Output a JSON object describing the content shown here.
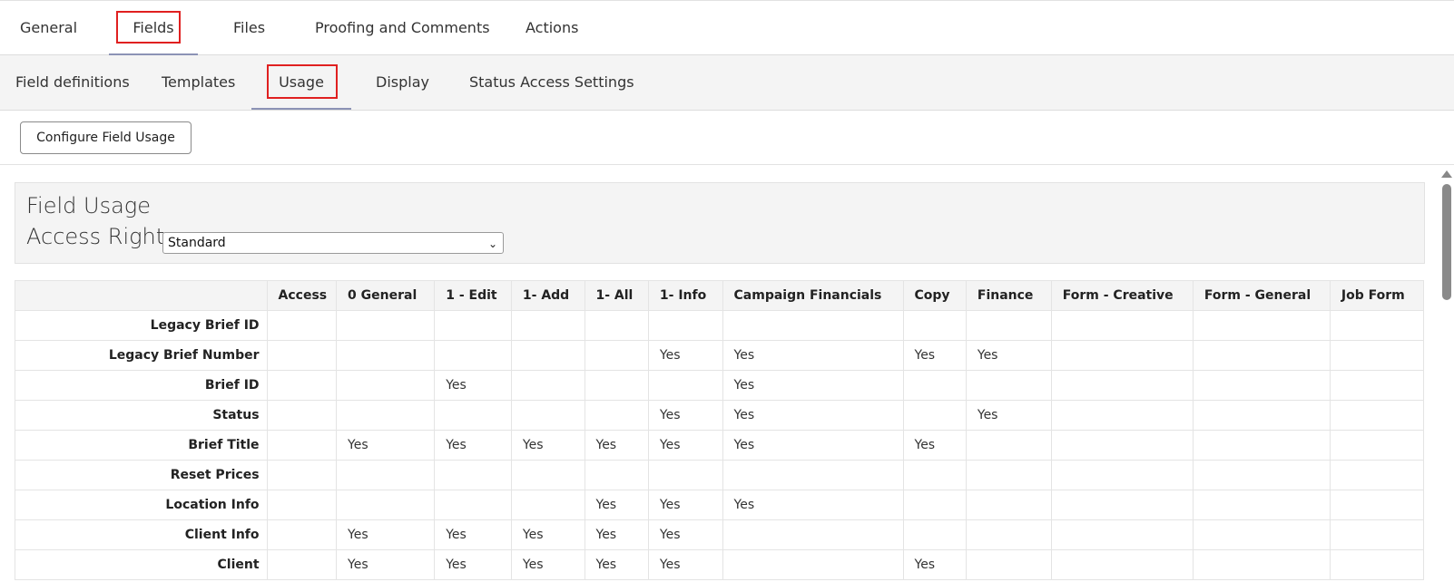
{
  "top_tabs": [
    "General",
    "Fields",
    "Files",
    "Proofing and Comments",
    "Actions"
  ],
  "sub_tabs": [
    "Field definitions",
    "Templates",
    "Usage",
    "Display",
    "Status Access Settings"
  ],
  "toolbar": {
    "configure_label": "Configure Field Usage"
  },
  "panel": {
    "title": "Field Usage",
    "access_right_label": "Access Right",
    "access_right_value": "Standard"
  },
  "table": {
    "columns": [
      "",
      "Access",
      "0 General",
      "1 - Edit",
      "1- Add",
      "1- All",
      "1- Info",
      "Campaign Financials",
      "Copy",
      "Finance",
      "Form - Creative",
      "Form - General",
      "Job Form"
    ],
    "rows": [
      {
        "label": "Legacy Brief ID",
        "cells": [
          "",
          "",
          "",
          "",
          "",
          "",
          "",
          "",
          "",
          "",
          "",
          ""
        ]
      },
      {
        "label": "Legacy Brief Number",
        "cells": [
          "",
          "",
          "",
          "",
          "",
          "Yes",
          "Yes",
          "Yes",
          "Yes",
          "",
          "",
          ""
        ]
      },
      {
        "label": "Brief ID",
        "cells": [
          "",
          "",
          "Yes",
          "",
          "",
          "",
          "Yes",
          "",
          "",
          "",
          "",
          ""
        ]
      },
      {
        "label": "Status",
        "cells": [
          "",
          "",
          "",
          "",
          "",
          "Yes",
          "Yes",
          "",
          "Yes",
          "",
          "",
          ""
        ]
      },
      {
        "label": "Brief Title",
        "cells": [
          "",
          "Yes",
          "Yes",
          "Yes",
          "Yes",
          "Yes",
          "Yes",
          "Yes",
          "",
          "",
          "",
          ""
        ]
      },
      {
        "label": "Reset Prices",
        "cells": [
          "",
          "",
          "",
          "",
          "",
          "",
          "",
          "",
          "",
          "",
          "",
          ""
        ]
      },
      {
        "label": "Location Info",
        "cells": [
          "",
          "",
          "",
          "",
          "Yes",
          "Yes",
          "Yes",
          "",
          "",
          "",
          "",
          ""
        ]
      },
      {
        "label": "Client Info",
        "cells": [
          "",
          "Yes",
          "Yes",
          "Yes",
          "Yes",
          "Yes",
          "",
          "",
          "",
          "",
          "",
          ""
        ]
      },
      {
        "label": "Client",
        "cells": [
          "",
          "Yes",
          "Yes",
          "Yes",
          "Yes",
          "Yes",
          "",
          "Yes",
          "",
          "",
          "",
          ""
        ]
      }
    ]
  },
  "colors": {
    "highlight": "#e02020",
    "underline": "#8c93b5",
    "panel_bg": "#f4f4f4"
  }
}
